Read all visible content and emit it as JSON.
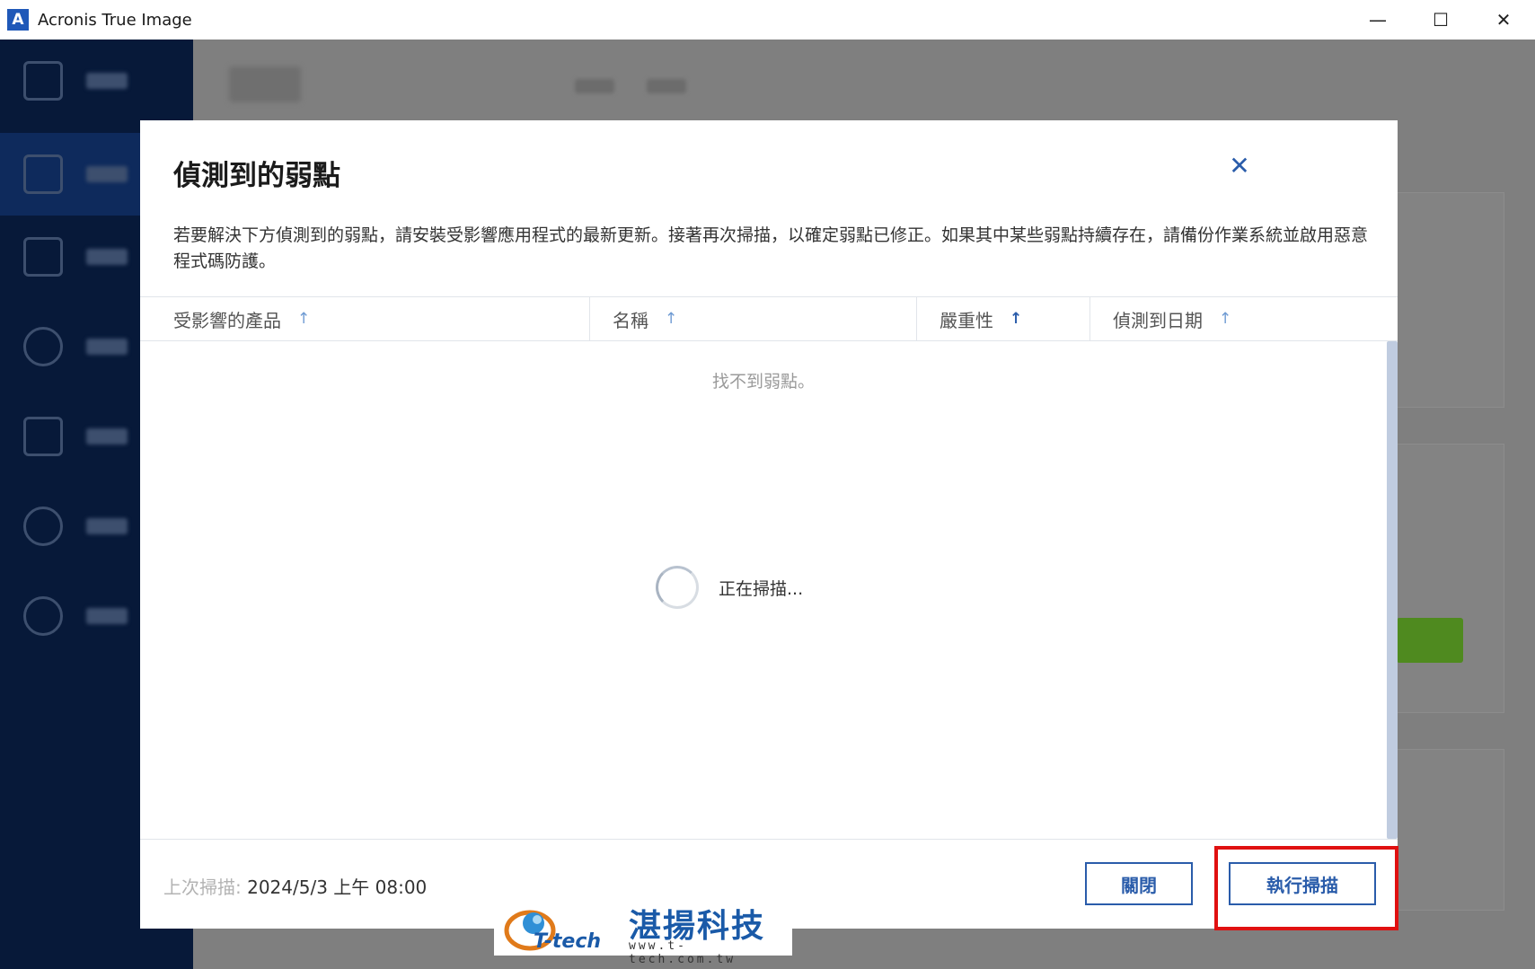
{
  "window": {
    "title": "Acronis True Image",
    "logo_letter": "A",
    "minimize_glyph": "—",
    "maximize_glyph": "☐",
    "close_glyph": "✕"
  },
  "dialog": {
    "title": "偵測到的弱點",
    "close_glyph": "✕",
    "description": "若要解決下方偵測到的弱點，請安裝受影響應用程式的最新更新。接著再次掃描，以確定弱點已修正。如果其中某些弱點持續存在，請備份作業系統並啟用惡意程式碼防護。",
    "columns": [
      {
        "label": "受影響的產品",
        "arrow": "↑"
      },
      {
        "label": "名稱",
        "arrow": "↑"
      },
      {
        "label": "嚴重性",
        "arrow": "↑"
      },
      {
        "label": "偵測到日期",
        "arrow": "↑"
      }
    ],
    "empty_message": "找不到弱點。",
    "loading_text": "正在掃描...",
    "last_scan_label": "上次掃描:",
    "last_scan_value": "2024/5/3 上午 08:00",
    "close_button": "關閉",
    "scan_button": "執行掃描"
  },
  "watermark": {
    "brand": "T-tech",
    "name_cn": "湛揚科技",
    "url": "www.t-tech.com.tw"
  },
  "colors": {
    "accent": "#2a5caa",
    "sidebar": "#071939",
    "highlight": "#e01010"
  }
}
